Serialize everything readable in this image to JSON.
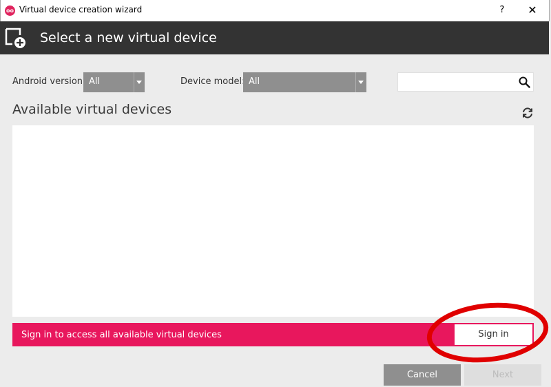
{
  "window": {
    "title": "Virtual device creation wizard",
    "app_icon_text": "oo",
    "help": "?",
    "close": "✕"
  },
  "header": {
    "title": "Select a new virtual device"
  },
  "filters": {
    "android_version_label": "Android version:",
    "android_version_value": "All",
    "device_model_label": "Device model:",
    "device_model_value": "All"
  },
  "search": {
    "value": "",
    "placeholder": ""
  },
  "devices": {
    "title": "Available virtual devices",
    "items": []
  },
  "signin": {
    "message": "Sign in to access all available virtual devices",
    "button_label": "Sign in"
  },
  "footer": {
    "cancel_label": "Cancel",
    "next_label": "Next"
  },
  "colors": {
    "header_bg": "#333333",
    "banner_bg": "#e8175d",
    "select_bg": "#8f8f8f",
    "annotation": "#e00000"
  }
}
